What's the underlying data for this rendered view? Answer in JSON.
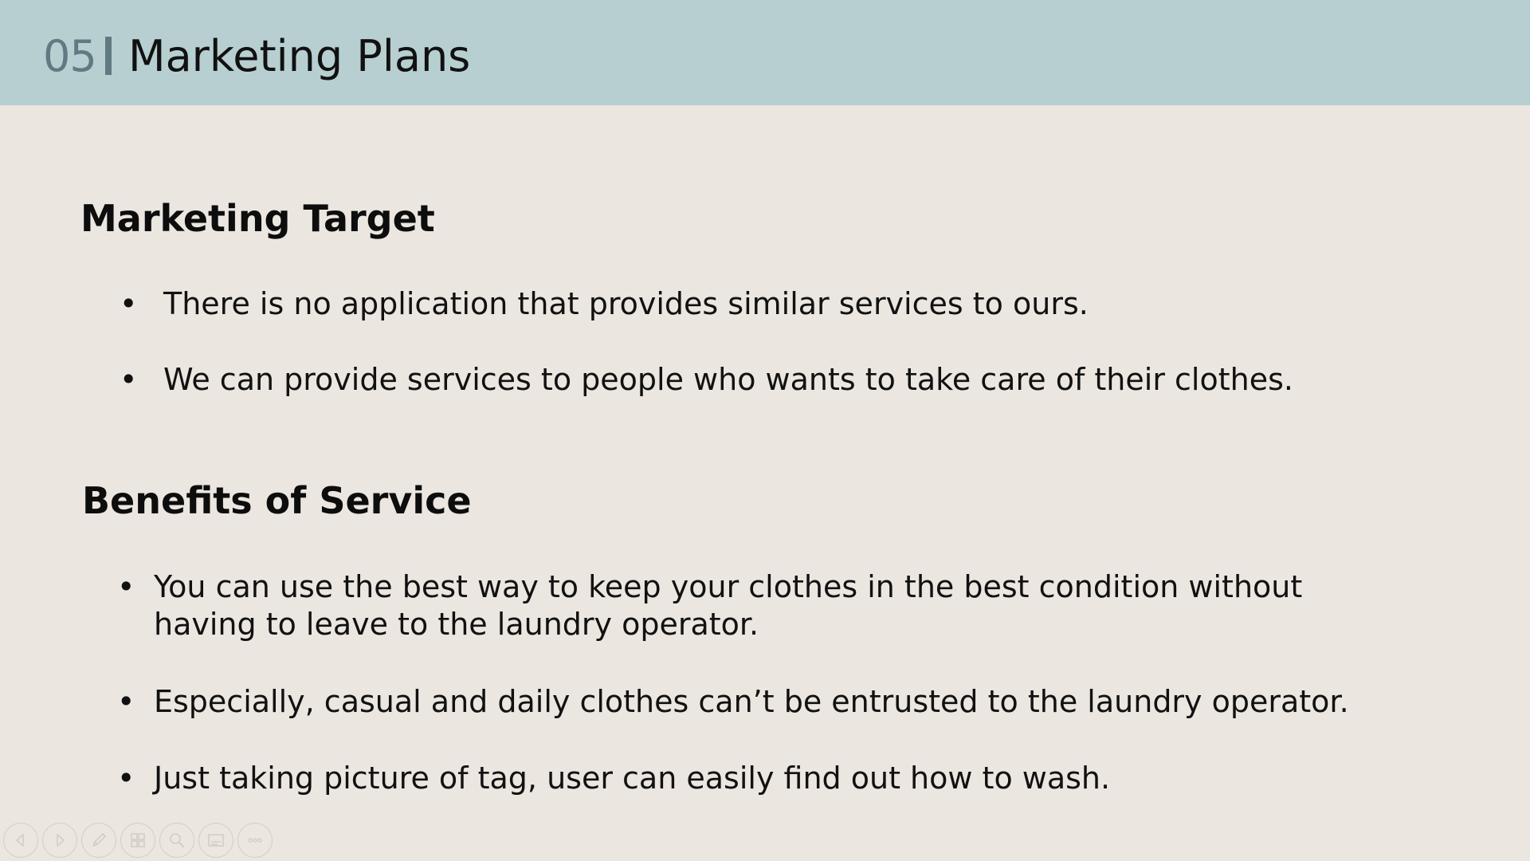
{
  "header": {
    "slide_number": "05",
    "title": "Marketing Plans"
  },
  "sections": [
    {
      "heading": "Marketing Target",
      "bullets": [
        "There is no application that provides similar services to ours.",
        "We can provide services to people who wants to take care of their clothes."
      ]
    },
    {
      "heading": "Benefits of Service",
      "bullets": [
        "You can use the best way to keep your clothes in the best condition without having to leave to the laundry operator.",
        "Especially, casual and daily clothes can’t be entrusted to the laundry operator.",
        "Just taking picture of tag, user can easily find out how to wash."
      ]
    }
  ],
  "bullet_glyph": "•",
  "colors": {
    "header_bg": "#b7cfd1",
    "slide_bg": "#ebe6e0",
    "accent": "#5f7a82",
    "control_outline": "#d2cdc7"
  },
  "controls": [
    {
      "icon": "previous-arrow-icon"
    },
    {
      "icon": "next-arrow-icon"
    },
    {
      "icon": "pen-icon"
    },
    {
      "icon": "slides-grid-icon"
    },
    {
      "icon": "zoom-icon"
    },
    {
      "icon": "subtitles-icon"
    },
    {
      "icon": "more-options-icon"
    }
  ]
}
